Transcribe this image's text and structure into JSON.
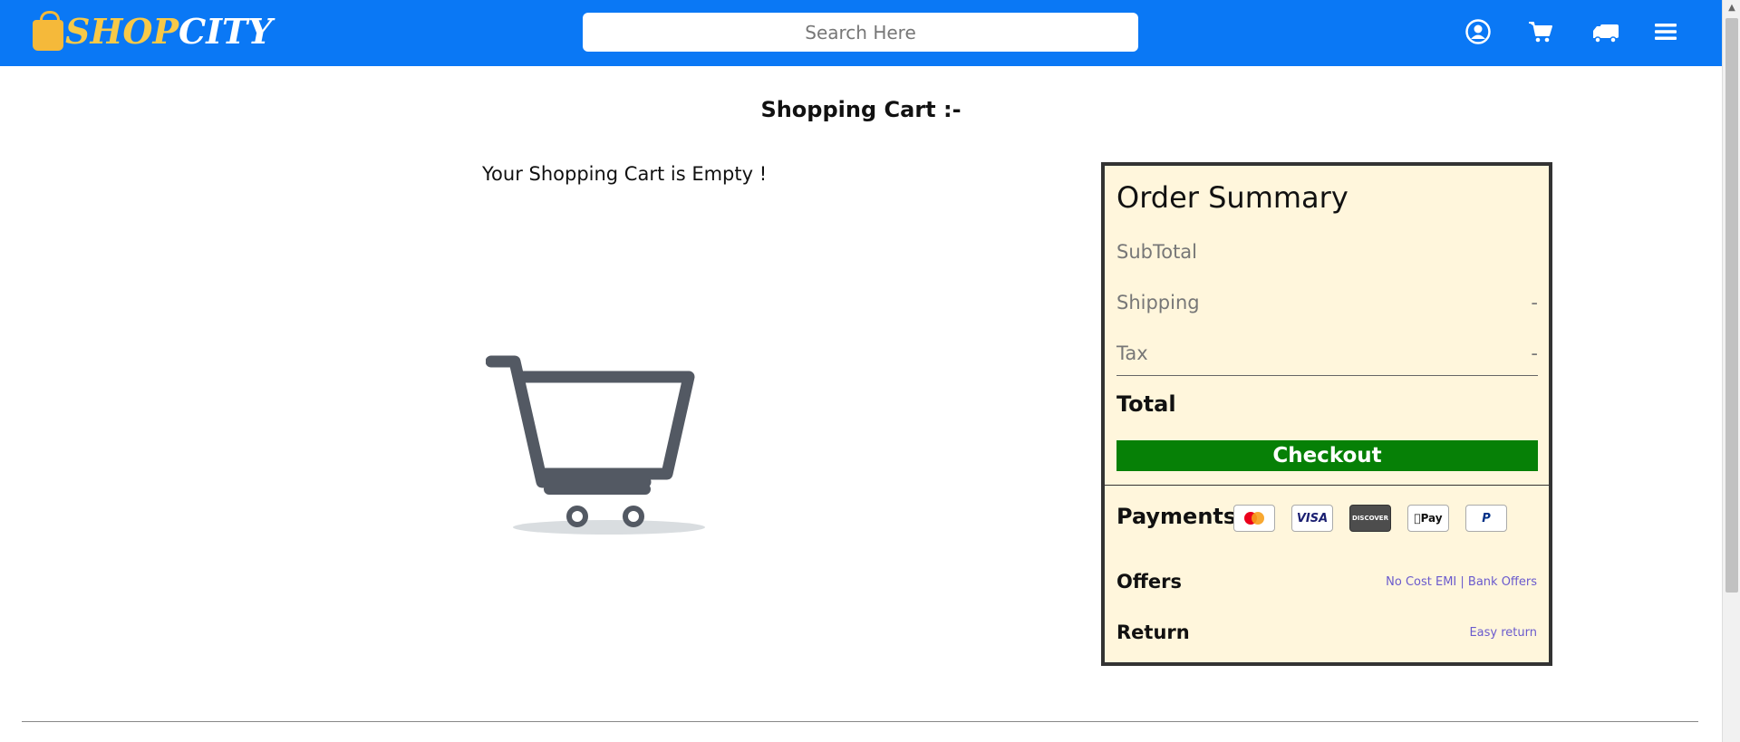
{
  "header": {
    "logo_shop": "SHOP",
    "logo_city": "CITY",
    "search_placeholder": "Search Here",
    "icons": [
      "user-circle-icon",
      "cart-icon",
      "truck-icon",
      "menu-icon"
    ]
  },
  "cart": {
    "title": "Shopping Cart :-",
    "empty_message": "Your Shopping Cart is Empty !"
  },
  "summary": {
    "title": "Order Summary",
    "rows": [
      {
        "label": "SubTotal",
        "value": ""
      },
      {
        "label": "Shipping",
        "value": "-"
      },
      {
        "label": "Tax",
        "value": "-"
      }
    ],
    "total_label": "Total",
    "checkout_label": "Checkout",
    "payments_label": "Payments",
    "payment_methods": [
      "Mastercard",
      "VISA",
      "DISCOVER",
      "Pay",
      "PayPal"
    ],
    "offers_label": "Offers",
    "offers_link": "No Cost EMI | Bank Offers",
    "return_label": "Return",
    "return_link": "Easy return"
  },
  "colors": {
    "header_bg": "#0a78f5",
    "summary_bg": "#fff6dc",
    "checkout_bg": "#068006",
    "link": "#6a5acd"
  }
}
